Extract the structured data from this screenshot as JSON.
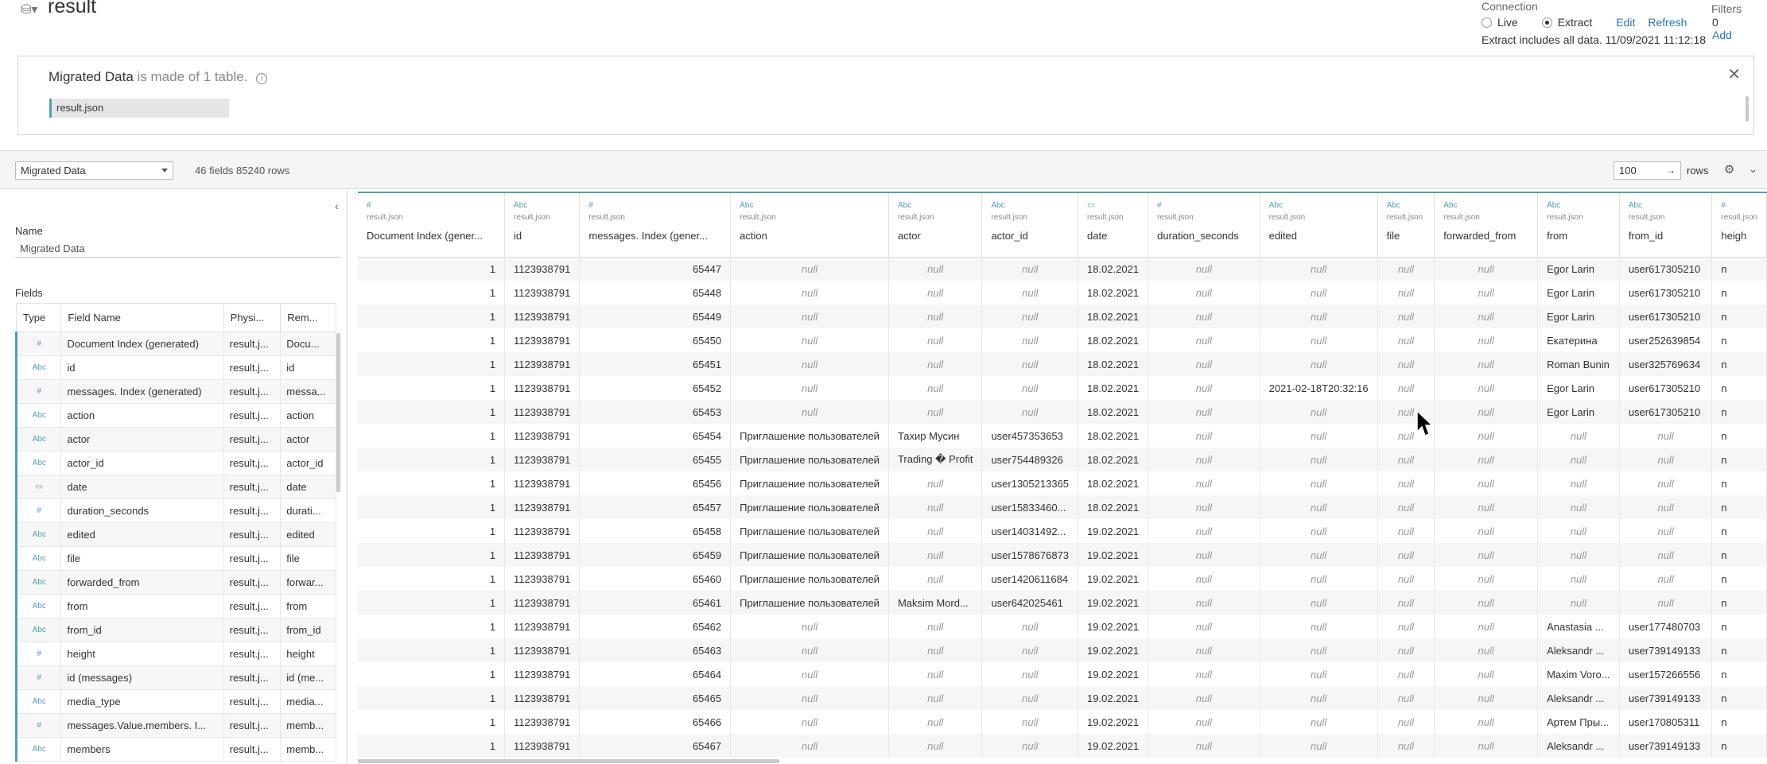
{
  "header": {
    "title": "result",
    "connection_label": "Connection",
    "live_label": "Live",
    "extract_label": "Extract",
    "edit_label": "Edit",
    "refresh_label": "Refresh",
    "extract_info": "Extract includes all data. 11/09/2021 11:12:18",
    "filters_label": "Filters",
    "filters_count": "0",
    "add_label": "Add"
  },
  "panel": {
    "name": "Migrated Data",
    "suffix": " is made of 1 table.",
    "table_chip": "result.json"
  },
  "toolbar": {
    "selected_source": "Migrated Data",
    "field_count": "46 fields 85240 rows",
    "rows_value": "100",
    "rows_label": "rows"
  },
  "sidebar": {
    "name_label": "Name",
    "name_value": "Migrated Data",
    "fields_label": "Fields",
    "columns": [
      "Type",
      "Field Name",
      "Physi...",
      "Rem..."
    ],
    "fields": [
      {
        "type": "#",
        "name": "Document Index (generated)",
        "phys": "result.j...",
        "rem": "Docu..."
      },
      {
        "type": "Abc",
        "name": "id",
        "phys": "result.j...",
        "rem": "id"
      },
      {
        "type": "#",
        "name": "messages. Index (generated)",
        "phys": "result.j...",
        "rem": "messa..."
      },
      {
        "type": "Abc",
        "name": "action",
        "phys": "result.j...",
        "rem": "action"
      },
      {
        "type": "Abc",
        "name": "actor",
        "phys": "result.j...",
        "rem": "actor"
      },
      {
        "type": "Abc",
        "name": "actor_id",
        "phys": "result.j...",
        "rem": "actor_id"
      },
      {
        "type": "▭",
        "name": "date",
        "phys": "result.j...",
        "rem": "date"
      },
      {
        "type": "#",
        "name": "duration_seconds",
        "phys": "result.j...",
        "rem": "durati..."
      },
      {
        "type": "Abc",
        "name": "edited",
        "phys": "result.j...",
        "rem": "edited"
      },
      {
        "type": "Abc",
        "name": "file",
        "phys": "result.j...",
        "rem": "file"
      },
      {
        "type": "Abc",
        "name": "forwarded_from",
        "phys": "result.j...",
        "rem": "forwar..."
      },
      {
        "type": "Abc",
        "name": "from",
        "phys": "result.j...",
        "rem": "from"
      },
      {
        "type": "Abc",
        "name": "from_id",
        "phys": "result.j...",
        "rem": "from_id"
      },
      {
        "type": "#",
        "name": "height",
        "phys": "result.j...",
        "rem": "height"
      },
      {
        "type": "#",
        "name": "id (messages)",
        "phys": "result.j...",
        "rem": "id (me..."
      },
      {
        "type": "Abc",
        "name": "media_type",
        "phys": "result.j...",
        "rem": "media..."
      },
      {
        "type": "#",
        "name": "messages.Value.members. I...",
        "phys": "result.j...",
        "rem": "memb..."
      },
      {
        "type": "Abc",
        "name": "members",
        "phys": "result.j...",
        "rem": "memb..."
      }
    ]
  },
  "grid": {
    "columns": [
      {
        "type": "#",
        "source": "result.json",
        "name": "Document Index (gener...",
        "align": "num"
      },
      {
        "type": "Abc",
        "source": "result.json",
        "name": "id",
        "align": "num"
      },
      {
        "type": "#",
        "source": "result.json",
        "name": "messages. Index (gener...",
        "align": "num"
      },
      {
        "type": "Abc",
        "source": "result.json",
        "name": "action",
        "align": "txt"
      },
      {
        "type": "Abc",
        "source": "result.json",
        "name": "actor",
        "align": "txt"
      },
      {
        "type": "Abc",
        "source": "result.json",
        "name": "actor_id",
        "align": "txt"
      },
      {
        "type": "▭",
        "source": "result.json",
        "name": "date",
        "align": "txt"
      },
      {
        "type": "#",
        "source": "result.json",
        "name": "duration_seconds",
        "align": "txt"
      },
      {
        "type": "Abc",
        "source": "result.json",
        "name": "edited",
        "align": "txt"
      },
      {
        "type": "Abc",
        "source": "result.json",
        "name": "file",
        "align": "txt"
      },
      {
        "type": "Abc",
        "source": "result.json",
        "name": "forwarded_from",
        "align": "txt"
      },
      {
        "type": "Abc",
        "source": "result.json",
        "name": "from",
        "align": "txt"
      },
      {
        "type": "Abc",
        "source": "result.json",
        "name": "from_id",
        "align": "txt"
      },
      {
        "type": "#",
        "source": "result.json",
        "name": "heigh",
        "align": "txt"
      }
    ],
    "rows": [
      [
        "1",
        "1123938791",
        "65447",
        "null",
        "null",
        "null",
        "18.02.2021",
        "null",
        "null",
        "null",
        "null",
        "Egor Larin",
        "user617305210",
        "n"
      ],
      [
        "1",
        "1123938791",
        "65448",
        "null",
        "null",
        "null",
        "18.02.2021",
        "null",
        "null",
        "null",
        "null",
        "Egor Larin",
        "user617305210",
        "n"
      ],
      [
        "1",
        "1123938791",
        "65449",
        "null",
        "null",
        "null",
        "18.02.2021",
        "null",
        "null",
        "null",
        "null",
        "Egor Larin",
        "user617305210",
        "n"
      ],
      [
        "1",
        "1123938791",
        "65450",
        "null",
        "null",
        "null",
        "18.02.2021",
        "null",
        "null",
        "null",
        "null",
        "Екатерина",
        "user252639854",
        "n"
      ],
      [
        "1",
        "1123938791",
        "65451",
        "null",
        "null",
        "null",
        "18.02.2021",
        "null",
        "null",
        "null",
        "null",
        "Roman Bunin",
        "user325769634",
        "n"
      ],
      [
        "1",
        "1123938791",
        "65452",
        "null",
        "null",
        "null",
        "18.02.2021",
        "null",
        "2021-02-18T20:32:16",
        "null",
        "null",
        "Egor Larin",
        "user617305210",
        "n"
      ],
      [
        "1",
        "1123938791",
        "65453",
        "null",
        "null",
        "null",
        "18.02.2021",
        "null",
        "null",
        "null",
        "null",
        "Egor Larin",
        "user617305210",
        "n"
      ],
      [
        "1",
        "1123938791",
        "65454",
        "Приглашение пользователей",
        "Тахир Мусин",
        "user457353653",
        "18.02.2021",
        "null",
        "null",
        "null",
        "null",
        "null",
        "null",
        "n"
      ],
      [
        "1",
        "1123938791",
        "65455",
        "Приглашение пользователей",
        "Trading � Profit",
        "user754489326",
        "18.02.2021",
        "null",
        "null",
        "null",
        "null",
        "null",
        "null",
        "n"
      ],
      [
        "1",
        "1123938791",
        "65456",
        "Приглашение пользователей",
        "null",
        "user1305213365",
        "18.02.2021",
        "null",
        "null",
        "null",
        "null",
        "null",
        "null",
        "n"
      ],
      [
        "1",
        "1123938791",
        "65457",
        "Приглашение пользователей",
        "null",
        "user15833460...",
        "18.02.2021",
        "null",
        "null",
        "null",
        "null",
        "null",
        "null",
        "n"
      ],
      [
        "1",
        "1123938791",
        "65458",
        "Приглашение пользователей",
        "null",
        "user14031492...",
        "19.02.2021",
        "null",
        "null",
        "null",
        "null",
        "null",
        "null",
        "n"
      ],
      [
        "1",
        "1123938791",
        "65459",
        "Приглашение пользователей",
        "null",
        "user1578676873",
        "19.02.2021",
        "null",
        "null",
        "null",
        "null",
        "null",
        "null",
        "n"
      ],
      [
        "1",
        "1123938791",
        "65460",
        "Приглашение пользователей",
        "null",
        "user1420611684",
        "19.02.2021",
        "null",
        "null",
        "null",
        "null",
        "null",
        "null",
        "n"
      ],
      [
        "1",
        "1123938791",
        "65461",
        "Приглашение пользователей",
        "Maksim Mord...",
        "user642025461",
        "19.02.2021",
        "null",
        "null",
        "null",
        "null",
        "null",
        "null",
        "n"
      ],
      [
        "1",
        "1123938791",
        "65462",
        "null",
        "null",
        "null",
        "19.02.2021",
        "null",
        "null",
        "null",
        "null",
        "Anastasia ...",
        "user177480703",
        "n"
      ],
      [
        "1",
        "1123938791",
        "65463",
        "null",
        "null",
        "null",
        "19.02.2021",
        "null",
        "null",
        "null",
        "null",
        "Aleksandr ...",
        "user739149133",
        "n"
      ],
      [
        "1",
        "1123938791",
        "65464",
        "null",
        "null",
        "null",
        "19.02.2021",
        "null",
        "null",
        "null",
        "null",
        "Maxim Voro...",
        "user157266556",
        "n"
      ],
      [
        "1",
        "1123938791",
        "65465",
        "null",
        "null",
        "null",
        "19.02.2021",
        "null",
        "null",
        "null",
        "null",
        "Aleksandr ...",
        "user739149133",
        "n"
      ],
      [
        "1",
        "1123938791",
        "65466",
        "null",
        "null",
        "null",
        "19.02.2021",
        "null",
        "null",
        "null",
        "null",
        "Артем Пры...",
        "user170805311",
        "n"
      ],
      [
        "1",
        "1123938791",
        "65467",
        "null",
        "null",
        "null",
        "19.02.2021",
        "null",
        "null",
        "null",
        "null",
        "Aleksandr ...",
        "user739149133",
        "n"
      ]
    ]
  },
  "icons": {
    "datasource": "database-icon",
    "info": "info-icon",
    "close": "close-icon",
    "settings": "gear-icon",
    "collapse": "chevron-left-icon",
    "cursor": "mouse-pointer-icon"
  },
  "colors": {
    "accent": "#4e9fb3",
    "link": "#1f77b4"
  }
}
